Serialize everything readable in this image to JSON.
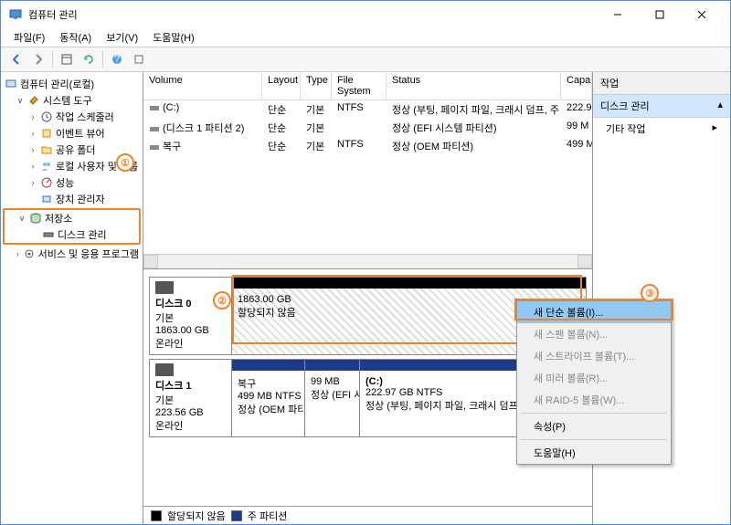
{
  "window": {
    "title": "컴퓨터 관리"
  },
  "menu": {
    "file": "파일(F)",
    "action": "동작(A)",
    "view": "보기(V)",
    "help": "도움말(H)"
  },
  "tree": {
    "root": "컴퓨터 관리(로컬)",
    "systools": "시스템 도구",
    "scheduler": "작업 스케줄러",
    "eventviewer": "이벤트 뷰어",
    "sharedfolders": "공유 폴더",
    "localusers": "로컬 사용자 및 그룹",
    "perf": "성능",
    "devmgr": "장치 관리자",
    "storage": "저장소",
    "diskmgmt": "디스크 관리",
    "services": "서비스 및 응용 프로그램"
  },
  "cols": {
    "volume": "Volume",
    "layout": "Layout",
    "type": "Type",
    "fs": "File System",
    "status": "Status",
    "capacity": "Capa"
  },
  "volumes": [
    {
      "name": "(C:)",
      "layout": "단순",
      "type": "기본",
      "fs": "NTFS",
      "status": "정상 (부팅, 페이지 파일, 크래시 덤프, 주 파티션)",
      "cap": "222.9"
    },
    {
      "name": "(디스크 1 파티션 2)",
      "layout": "단순",
      "type": "기본",
      "fs": "",
      "status": "정상 (EFI 시스템 파티션)",
      "cap": "99 M"
    },
    {
      "name": "복구",
      "layout": "단순",
      "type": "기본",
      "fs": "NTFS",
      "status": "정상 (OEM 파티션)",
      "cap": "499 M"
    }
  ],
  "disk0": {
    "name": "디스크 0",
    "type": "기본",
    "size": "1863.00 GB",
    "state": "온라인",
    "part_size": "1863.00 GB",
    "part_state": "할당되지 않음"
  },
  "disk1": {
    "name": "디스크 1",
    "type": "기본",
    "size": "223.56 GB",
    "state": "온라인",
    "p1": {
      "name": "복구",
      "size": "499 MB NTFS",
      "status": "정상 (OEM 파티션)"
    },
    "p2": {
      "name": "",
      "size": "99 MB",
      "status": "정상 (EFI 시스템 파티션)"
    },
    "p3": {
      "name": "(C:)",
      "size": "222.97 GB NTFS",
      "status": "정상 (부팅, 페이지 파일, 크래시 덤프)"
    }
  },
  "legend": {
    "unalloc": "할당되지 않음",
    "primary": "주 파티션"
  },
  "actions": {
    "header": "작업",
    "diskmgmt": "디스크 관리",
    "more": "기타 작업"
  },
  "ctx": {
    "simple": "새 단순 볼륨(I)...",
    "span": "새 스팬 볼륨(N)...",
    "stripe": "새 스트라이프 볼륨(T)...",
    "mirror": "새 미러 볼륨(R)...",
    "raid5": "새 RAID-5 볼륨(W)...",
    "props": "속성(P)",
    "help": "도움말(H)"
  },
  "callouts": {
    "c1": "①",
    "c2": "②",
    "c3": "③"
  }
}
